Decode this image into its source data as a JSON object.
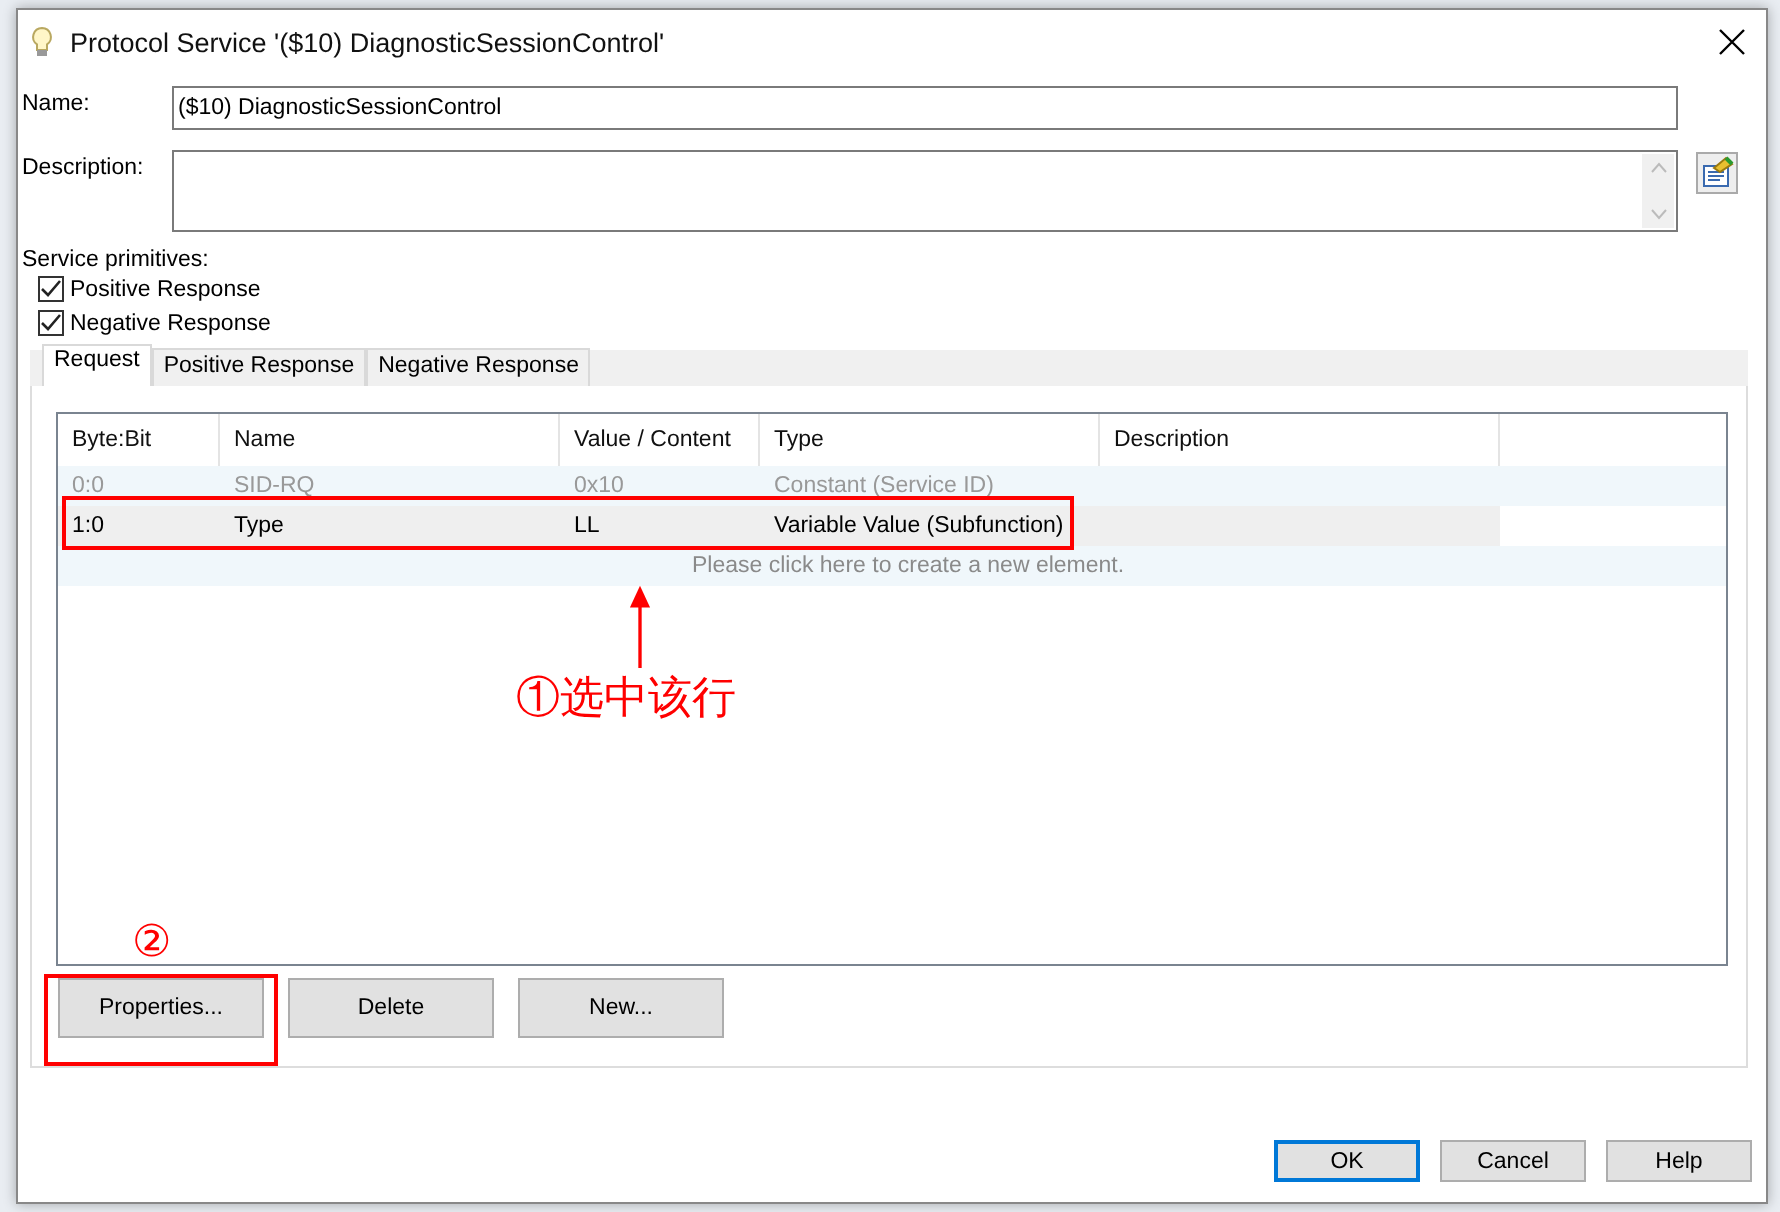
{
  "window": {
    "title": "Protocol Service '($10) DiagnosticSessionControl'"
  },
  "name_field": {
    "label": "Name:",
    "value": "($10) DiagnosticSessionControl"
  },
  "description_field": {
    "label": "Description:"
  },
  "service_primitives": {
    "label": "Service primitives:",
    "items": [
      {
        "label": "Positive Response",
        "checked": true
      },
      {
        "label": "Negative Response",
        "checked": true
      }
    ]
  },
  "tabs": [
    {
      "label": "Request",
      "selected": true
    },
    {
      "label": "Positive Response",
      "selected": false
    },
    {
      "label": "Negative Response",
      "selected": false
    }
  ],
  "table": {
    "columns": [
      "Byte:Bit",
      "Name",
      "Value / Content",
      "Type",
      "Description"
    ],
    "rows": [
      {
        "cells": [
          "0:0",
          "SID-RQ",
          "0x10",
          "Constant (Service ID)",
          ""
        ],
        "greyed": true,
        "selected": false
      },
      {
        "cells": [
          "1:0",
          "Type",
          "LL",
          "Variable Value (Subfunction)",
          ""
        ],
        "greyed": false,
        "selected": true
      }
    ],
    "new_row_hint": "Please click here to create a new element."
  },
  "table_buttons": [
    "Properties...",
    "Delete",
    "New..."
  ],
  "dialog_buttons": [
    {
      "label": "OK",
      "default": true
    },
    {
      "label": "Cancel",
      "default": false
    },
    {
      "label": "Help",
      "default": false
    }
  ],
  "annotations": [
    {
      "kind": "row-highlight",
      "text": "①选中该行"
    },
    {
      "kind": "button-highlight",
      "text": "②"
    }
  ]
}
